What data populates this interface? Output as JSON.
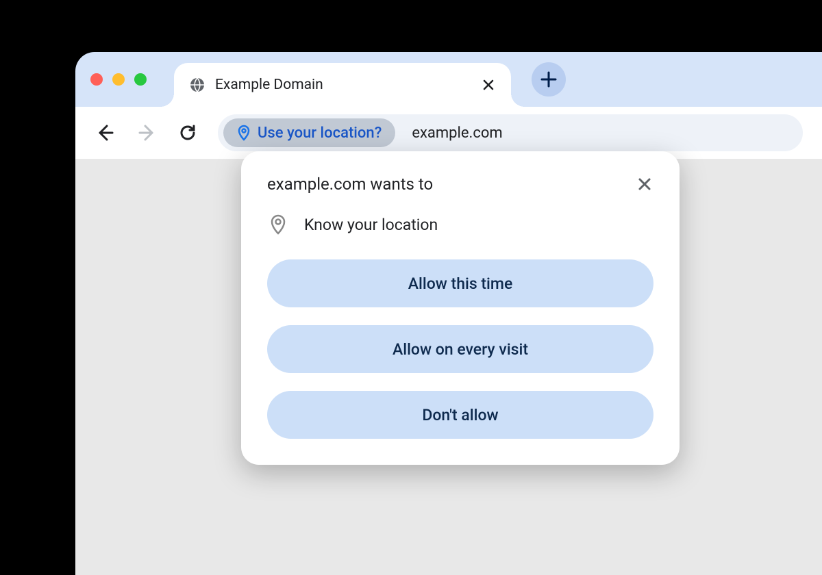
{
  "tab": {
    "title": "Example Domain"
  },
  "omnibox": {
    "permission_chip": "Use your location?",
    "url": "example.com"
  },
  "popup": {
    "title": "example.com wants to",
    "permission_text": "Know your location",
    "buttons": {
      "allow_once": "Allow this time",
      "allow_always": "Allow on every visit",
      "deny": "Don't allow"
    }
  }
}
